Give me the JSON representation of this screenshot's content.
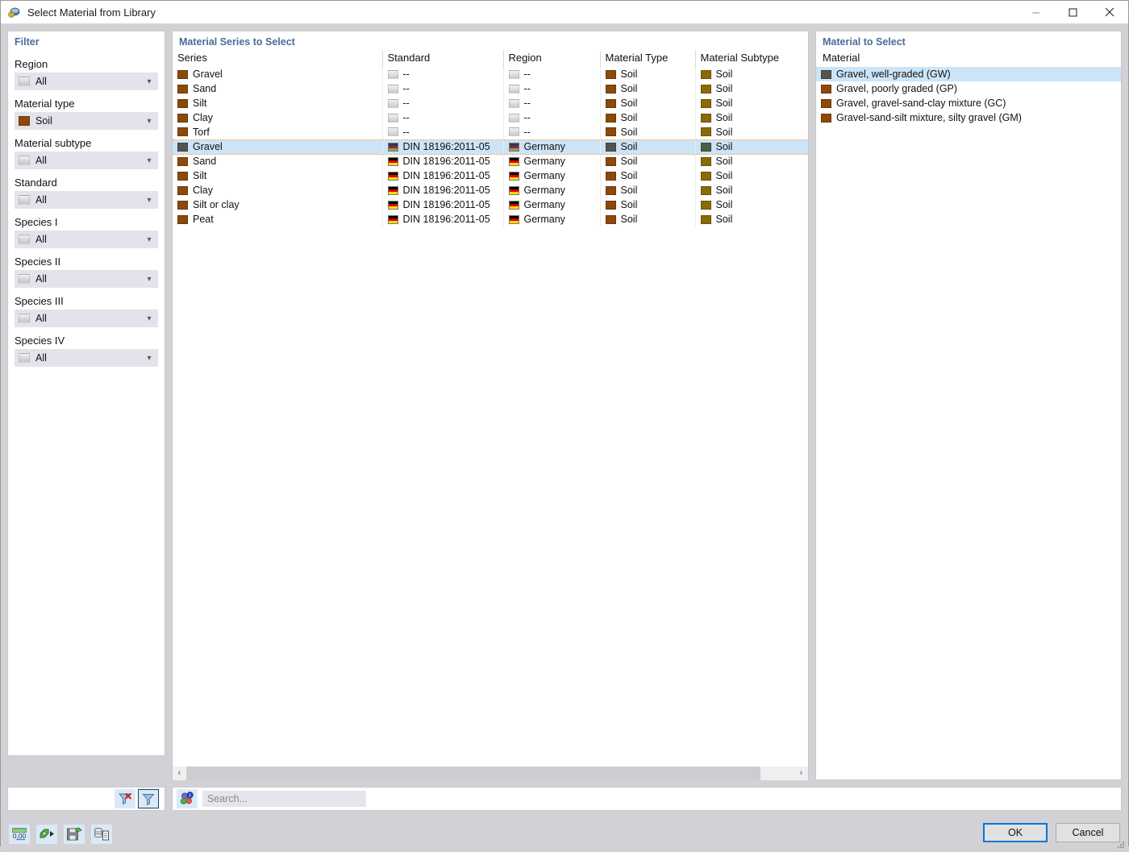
{
  "window": {
    "title": "Select Material from Library",
    "app_icon": "library-material-icon",
    "minimize_label": "Minimize",
    "maximize_label": "Maximize",
    "close_label": "Close"
  },
  "filter": {
    "title": "Filter",
    "groups": [
      {
        "label": "Region",
        "value": "All",
        "swatch": "gray"
      },
      {
        "label": "Material type",
        "value": "Soil",
        "swatch": "soil"
      },
      {
        "label": "Material subtype",
        "value": "All",
        "swatch": "gray"
      },
      {
        "label": "Standard",
        "value": "All",
        "swatch": "gray"
      },
      {
        "label": "Species I",
        "value": "All",
        "swatch": "gray"
      },
      {
        "label": "Species II",
        "value": "All",
        "swatch": "gray"
      },
      {
        "label": "Species III",
        "value": "All",
        "swatch": "gray"
      },
      {
        "label": "Species IV",
        "value": "All",
        "swatch": "gray"
      }
    ],
    "actions": {
      "clear_filter_label": "Clear filter",
      "apply_filter_label": "Filter"
    }
  },
  "series_panel": {
    "title": "Material Series to Select",
    "columns": [
      "Series",
      "Standard",
      "Region",
      "Material Type",
      "Material Subtype"
    ],
    "rows": [
      {
        "series": "Gravel",
        "standard": "--",
        "region": "--",
        "material_type": "Soil",
        "material_subtype": "Soil",
        "selected": false
      },
      {
        "series": "Sand",
        "standard": "--",
        "region": "--",
        "material_type": "Soil",
        "material_subtype": "Soil",
        "selected": false
      },
      {
        "series": "Silt",
        "standard": "--",
        "region": "--",
        "material_type": "Soil",
        "material_subtype": "Soil",
        "selected": false
      },
      {
        "series": "Clay",
        "standard": "--",
        "region": "--",
        "material_type": "Soil",
        "material_subtype": "Soil",
        "selected": false
      },
      {
        "series": "Torf",
        "standard": "--",
        "region": "--",
        "material_type": "Soil",
        "material_subtype": "Soil",
        "selected": false
      },
      {
        "series": "Gravel",
        "standard": "DIN 18196:2011-05",
        "region": "Germany",
        "material_type": "Soil",
        "material_subtype": "Soil",
        "selected": true
      },
      {
        "series": "Sand",
        "standard": "DIN 18196:2011-05",
        "region": "Germany",
        "material_type": "Soil",
        "material_subtype": "Soil",
        "selected": false
      },
      {
        "series": "Silt",
        "standard": "DIN 18196:2011-05",
        "region": "Germany",
        "material_type": "Soil",
        "material_subtype": "Soil",
        "selected": false
      },
      {
        "series": "Clay",
        "standard": "DIN 18196:2011-05",
        "region": "Germany",
        "material_type": "Soil",
        "material_subtype": "Soil",
        "selected": false
      },
      {
        "series": "Silt or clay",
        "standard": "DIN 18196:2011-05",
        "region": "Germany",
        "material_type": "Soil",
        "material_subtype": "Soil",
        "selected": false
      },
      {
        "series": "Peat",
        "standard": "DIN 18196:2011-05",
        "region": "Germany",
        "material_type": "Soil",
        "material_subtype": "Soil",
        "selected": false
      }
    ],
    "scroll_left_label": "‹",
    "scroll_right_label": "›"
  },
  "material_panel": {
    "title": "Material to Select",
    "column": "Material",
    "items": [
      {
        "label": "Gravel, well-graded (GW)",
        "selected": true
      },
      {
        "label": "Gravel, poorly graded (GP)",
        "selected": false
      },
      {
        "label": "Gravel, gravel-sand-clay mixture (GC)",
        "selected": false
      },
      {
        "label": "Gravel-sand-silt mixture, silty gravel (GM)",
        "selected": false
      }
    ]
  },
  "search": {
    "placeholder": "Search...",
    "value": "",
    "icon_label": "search-filter-icon"
  },
  "footer": {
    "tools": [
      {
        "name": "decimal-places-icon",
        "label": "0,00"
      },
      {
        "name": "export-material-icon",
        "label": "Export"
      },
      {
        "name": "save-material-icon",
        "label": "Save"
      },
      {
        "name": "database-document-icon",
        "label": "Database"
      }
    ],
    "ok_label": "OK",
    "cancel_label": "Cancel"
  },
  "colors": {
    "selection": "#cce4f7",
    "focus_outline": "#e08a3c",
    "panel_title": "#4a6a9a",
    "soil_brown": "#8b4a0a",
    "soil_subtype": "#8a6a08",
    "accent_blue": "#0078d7"
  }
}
